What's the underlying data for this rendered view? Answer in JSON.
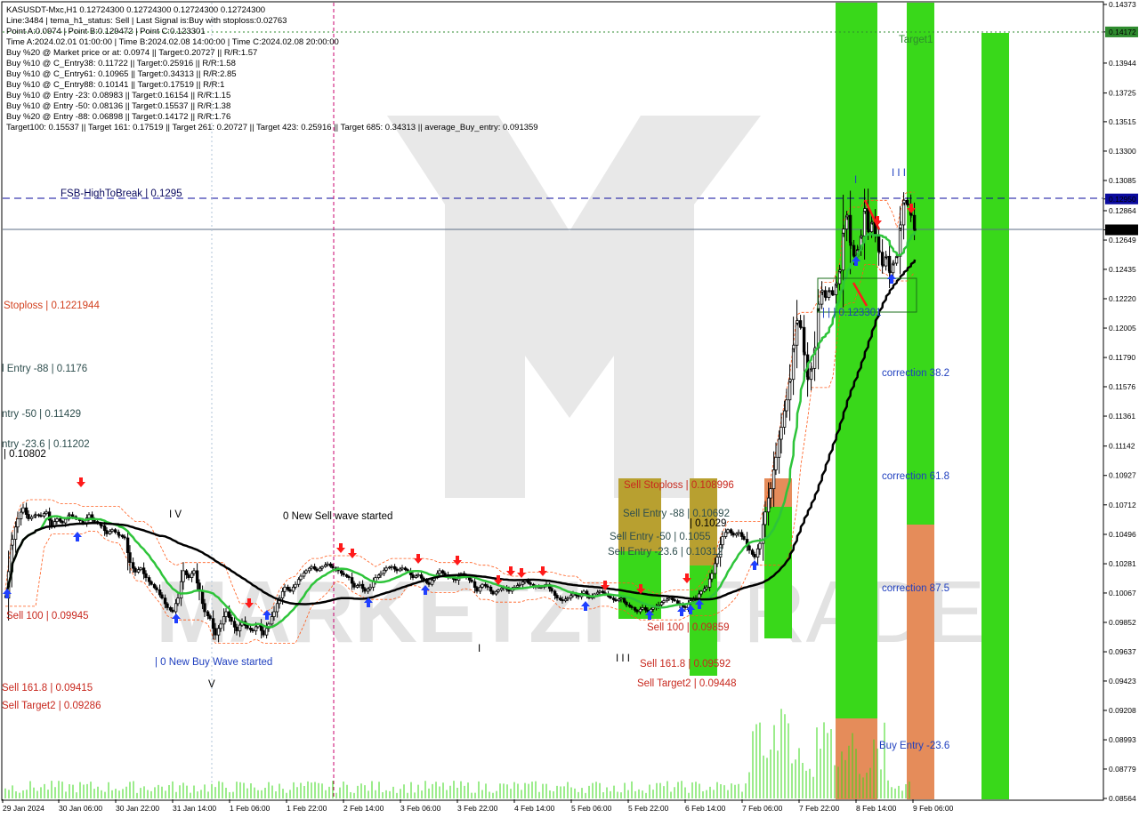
{
  "info_lines": [
    "KASUSDT-Mxc,H1  0.12724300 0.12724300 0.12724300 0.12724300",
    "Line:3484 | tema_h1_status: Sell | Last Signal is:Buy with stoploss:0.02763",
    "Point A:0.0974 | Point B:0.129472 | Point C:0.123301",
    "Time A:2024.02.01 01:00:00 | Time B:2024.02.08 14:00:00 | Time C:2024.02.08 20:00:00",
    "Buy %20 @ Market price or at: 0.0974 || Target:0.20727 || R/R:1.57",
    "Buy %10 @ C_Entry38: 0.11722 || Target:0.25916 || R/R:1.58",
    "Buy %10 @ C_Entry61: 0.10965 || Target:0.34313 || R/R:2.85",
    "Buy %10 @ C_Entry88: 0.10141 || Target:0.17519 || R/R:1",
    "Buy %10 @ Entry -23: 0.08983 || Target:0.16154 || R/R:1.15",
    "Buy %10 @ Entry -50: 0.08136 || Target:0.15537 || R/R:1.38",
    "Buy %20 @ Entry -88: 0.06898 || Target:0.14172 || R/R:1.76",
    "Target100: 0.15537 || Target 161: 0.17519 || Target 261: 0.20727 || Target 423: 0.25916 || Target 685: 0.34313 || average_Buy_entry: 0.091359"
  ],
  "price_axis": {
    "ticks": [
      "0.14373",
      "0.14172",
      "0.13944",
      "0.13725",
      "0.13515",
      "0.13300",
      "0.13085",
      "0.12950",
      "0.12864",
      "0.12724",
      "0.12649",
      "0.12435",
      "0.12220",
      "0.12005",
      "0.11790",
      "0.11576",
      "0.11361",
      "0.11142",
      "0.10927",
      "0.10712",
      "0.10496",
      "0.10281",
      "0.10067",
      "0.09852",
      "0.09637",
      "0.09423",
      "0.09208",
      "0.08993",
      "0.08779",
      "0.08564"
    ],
    "highlight_target": "0.14172",
    "highlight_fsb": "0.12950",
    "highlight_current": "0.12724"
  },
  "time_axis": [
    "29 Jan 2024",
    "30 Jan 06:00",
    "30 Jan 22:00",
    "31 Jan 14:00",
    "1 Feb 06:00",
    "1 Feb 22:00",
    "2 Feb 14:00",
    "3 Feb 06:00",
    "3 Feb 22:00",
    "4 Feb 14:00",
    "5 Feb 06:00",
    "5 Feb 22:00",
    "6 Feb 14:00",
    "7 Feb 06:00",
    "7 Feb 22:00",
    "8 Feb 14:00",
    "9 Feb 06:00"
  ],
  "annotations": {
    "target1": "Target1",
    "fsb": "FSB-HighToBreak | 0.1295",
    "stoploss": "Stoploss | 0.1221944",
    "entry88": "l Entry -88 | 0.1176",
    "entry50": "ntry -50 | 0.11429",
    "entry23": "ntry -23.6 | 0.11202",
    "level_10802": "| 0.10802",
    "sell100_left": "Sell 100 | 0.09945",
    "new_buy_wave": "| 0 New Buy Wave started",
    "sell161_left": "Sell 161.8 | 0.09415",
    "sell_target2_left": "Sell Target2 | 0.09286",
    "new_sell_wave": "0 New Sell wave started",
    "sell_stoploss": "Sell Stoploss | 0.108996",
    "sell_entry88": "Sell Entry -88 | 0.10692",
    "sell_entry50": "Sell Entry -50 | 0.1055",
    "sell_entry23": "Sell Entry -23.6 | 0.10312",
    "level_1029": "| 0.1029",
    "sell100_mid": "Sell 100 | 0.09859",
    "sell161_mid": "Sell 161.8 | 0.09592",
    "sell_target2_mid": "Sell Target2 | 0.09448",
    "point_c": "| | | 0.123301",
    "correction382": "correction 38.2",
    "correction618": "correction 61.8",
    "correction875": "correction 87.5",
    "buy_entry23": "Buy Entry -23.6",
    "v_mark": "V",
    "iv_mark": "I V",
    "tick_marks": "I I I",
    "tick_marks2": "I I I",
    "i_mark": "I"
  },
  "watermark": {
    "text_left": "MARKETZI",
    "text_right": "TRADE"
  },
  "colors": {
    "green_zone": "#39d81a",
    "orange_zone": "#e58c5a",
    "olive_zone": "#b8a030",
    "ma_green": "#2ec43a",
    "ma_black": "#000000",
    "buy_arrow": "#1f3fff",
    "sell_arrow": "#ff1a1a",
    "envelope": "#ff5a1a",
    "fsb_line": "#0a0a9e",
    "annotation_red": "#c8281e",
    "annotation_blue": "#1f3fbf",
    "target_line": "#2e8b2e"
  },
  "chart_data": {
    "type": "candlestick",
    "symbol": "KASUSDT-Mxc",
    "timeframe": "H1",
    "ylim": [
      0.08564,
      0.14373
    ],
    "x_range": [
      "29 Jan 2024",
      "9 Feb 06:00"
    ],
    "current_price": 0.12724,
    "levels": [
      {
        "label": "Target1",
        "value": 0.14172
      },
      {
        "label": "FSB-HighToBreak",
        "value": 0.1295
      },
      {
        "label": "Stoploss",
        "value": 0.1221944
      },
      {
        "label": "Entry -88",
        "value": 0.1176
      },
      {
        "label": "Entry -50",
        "value": 0.11429
      },
      {
        "label": "Entry -23.6",
        "value": 0.11202
      },
      {
        "label": "Sell Stoploss",
        "value": 0.108996
      },
      {
        "label": "Sell Entry -88",
        "value": 0.10692
      },
      {
        "label": "Sell Entry -50",
        "value": 0.1055
      },
      {
        "label": "Sell Entry -23.6",
        "value": 0.10312
      },
      {
        "label": "Sell 100",
        "value": 0.09945
      },
      {
        "label": "Sell 100",
        "value": 0.09859
      },
      {
        "label": "Sell 161.8",
        "value": 0.09592
      },
      {
        "label": "Sell Target2",
        "value": 0.09448
      },
      {
        "label": "Sell 161.8",
        "value": 0.09415
      },
      {
        "label": "Sell Target2",
        "value": 0.09286
      }
    ],
    "close_path": [
      [
        0,
        0.1003
      ],
      [
        8,
        0.1046
      ],
      [
        14,
        0.1061
      ],
      [
        20,
        0.1069
      ],
      [
        26,
        0.1061
      ],
      [
        34,
        0.1064
      ],
      [
        40,
        0.1063
      ],
      [
        46,
        0.1066
      ],
      [
        52,
        0.1056
      ],
      [
        58,
        0.1061
      ],
      [
        64,
        0.1058
      ],
      [
        72,
        0.1064
      ],
      [
        80,
        0.1061
      ],
      [
        88,
        0.1058
      ],
      [
        94,
        0.1064
      ],
      [
        100,
        0.1059
      ],
      [
        108,
        0.1056
      ],
      [
        114,
        0.105
      ],
      [
        120,
        0.1053
      ],
      [
        128,
        0.1049
      ],
      [
        134,
        0.1047
      ],
      [
        140,
        0.1029
      ],
      [
        146,
        0.1022
      ],
      [
        152,
        0.1025
      ],
      [
        158,
        0.1018
      ],
      [
        164,
        0.1013
      ],
      [
        170,
        0.1009
      ],
      [
        176,
        0.1003
      ],
      [
        182,
        0.0996
      ],
      [
        188,
        0.0993
      ],
      [
        194,
        0.1003
      ],
      [
        200,
        0.1023
      ],
      [
        206,
        0.1018
      ],
      [
        212,
        0.1023
      ],
      [
        218,
        0.1008
      ],
      [
        224,
        0.0993
      ],
      [
        230,
        0.0988
      ],
      [
        236,
        0.0976
      ],
      [
        242,
        0.0984
      ],
      [
        248,
        0.0993
      ],
      [
        254,
        0.0986
      ],
      [
        260,
        0.0979
      ],
      [
        266,
        0.0986
      ],
      [
        272,
        0.0981
      ],
      [
        278,
        0.0979
      ],
      [
        284,
        0.0984
      ],
      [
        290,
        0.0976
      ],
      [
        296,
        0.0984
      ],
      [
        302,
        0.0993
      ],
      [
        308,
        0.1003
      ],
      [
        314,
        0.1011
      ],
      [
        320,
        0.1008
      ],
      [
        326,
        0.1013
      ],
      [
        332,
        0.1019
      ],
      [
        338,
        0.1023
      ],
      [
        344,
        0.1026
      ],
      [
        350,
        0.1023
      ],
      [
        356,
        0.1026
      ],
      [
        362,
        0.1028
      ],
      [
        368,
        0.1025
      ],
      [
        374,
        0.1023
      ],
      [
        380,
        0.102
      ],
      [
        386,
        0.1018
      ],
      [
        392,
        0.1011
      ],
      [
        398,
        0.1013
      ],
      [
        404,
        0.1008
      ],
      [
        410,
        0.1011
      ],
      [
        416,
        0.1018
      ],
      [
        422,
        0.1021
      ],
      [
        428,
        0.1025
      ],
      [
        434,
        0.1026
      ],
      [
        440,
        0.1023
      ],
      [
        446,
        0.1025
      ],
      [
        452,
        0.1023
      ],
      [
        458,
        0.1018
      ],
      [
        464,
        0.102
      ],
      [
        470,
        0.1016
      ],
      [
        476,
        0.1013
      ],
      [
        482,
        0.1018
      ],
      [
        488,
        0.1023
      ],
      [
        494,
        0.102
      ],
      [
        500,
        0.1018
      ],
      [
        506,
        0.1016
      ],
      [
        512,
        0.1021
      ],
      [
        518,
        0.1018
      ],
      [
        524,
        0.1015
      ],
      [
        530,
        0.1008
      ],
      [
        536,
        0.1013
      ],
      [
        542,
        0.1011
      ],
      [
        548,
        0.1006
      ],
      [
        554,
        0.1009
      ],
      [
        560,
        0.1011
      ],
      [
        566,
        0.1008
      ],
      [
        572,
        0.1011
      ],
      [
        578,
        0.1013
      ],
      [
        584,
        0.1016
      ],
      [
        590,
        0.1013
      ],
      [
        596,
        0.1011
      ],
      [
        602,
        0.1011
      ],
      [
        608,
        0.1013
      ],
      [
        614,
        0.1008
      ],
      [
        620,
        0.1003
      ],
      [
        626,
        0.1001
      ],
      [
        632,
        0.1003
      ],
      [
        638,
        0.1006
      ],
      [
        644,
        0.1004
      ],
      [
        650,
        0.1008
      ],
      [
        656,
        0.1003
      ],
      [
        662,
        0.1006
      ],
      [
        668,
        0.1008
      ],
      [
        674,
        0.1006
      ],
      [
        680,
        0.1003
      ],
      [
        686,
        0.1001
      ],
      [
        692,
        0.1003
      ],
      [
        698,
        0.0998
      ],
      [
        704,
        0.0996
      ],
      [
        710,
        0.0993
      ],
      [
        716,
        0.0996
      ],
      [
        722,
        0.0993
      ],
      [
        728,
        0.0996
      ],
      [
        734,
        0.0998
      ],
      [
        740,
        0.1001
      ],
      [
        746,
        0.1003
      ],
      [
        752,
        0.1001
      ],
      [
        758,
        0.0998
      ],
      [
        764,
        0.0996
      ],
      [
        770,
        0.1001
      ],
      [
        776,
        0.1003
      ],
      [
        782,
        0.1008
      ],
      [
        788,
        0.1011
      ],
      [
        794,
        0.1021
      ],
      [
        800,
        0.1033
      ],
      [
        806,
        0.1048
      ],
      [
        812,
        0.1053
      ],
      [
        818,
        0.1049
      ],
      [
        824,
        0.1051
      ],
      [
        830,
        0.1046
      ],
      [
        836,
        0.1038
      ],
      [
        842,
        0.1033
      ],
      [
        848,
        0.1043
      ],
      [
        854,
        0.1066
      ],
      [
        860,
        0.1083
      ],
      [
        866,
        0.1106
      ],
      [
        872,
        0.1128
      ],
      [
        878,
        0.1148
      ],
      [
        882,
        0.1163
      ],
      [
        886,
        0.1188
      ],
      [
        890,
        0.1206
      ],
      [
        894,
        0.1201
      ],
      [
        898,
        0.1181
      ],
      [
        902,
        0.1163
      ],
      [
        906,
        0.1171
      ],
      [
        910,
        0.1186
      ],
      [
        914,
        0.1218
      ],
      [
        918,
        0.1228
      ],
      [
        922,
        0.1223
      ],
      [
        926,
        0.1228
      ],
      [
        930,
        0.1225
      ],
      [
        934,
        0.1233
      ],
      [
        938,
        0.1243
      ],
      [
        942,
        0.1273
      ],
      [
        946,
        0.1283
      ],
      [
        950,
        0.1261
      ],
      [
        954,
        0.1253
      ],
      [
        958,
        0.1258
      ],
      [
        962,
        0.1268
      ],
      [
        966,
        0.1288
      ],
      [
        970,
        0.1271
      ],
      [
        974,
        0.1278
      ],
      [
        978,
        0.1268
      ],
      [
        982,
        0.1256
      ],
      [
        986,
        0.1246
      ],
      [
        990,
        0.1253
      ],
      [
        994,
        0.1241
      ],
      [
        998,
        0.1248
      ],
      [
        1002,
        0.1253
      ],
      [
        1006,
        0.1276
      ],
      [
        1010,
        0.1294
      ],
      [
        1014,
        0.1291
      ],
      [
        1018,
        0.1283
      ],
      [
        1022,
        0.1272
      ]
    ]
  }
}
